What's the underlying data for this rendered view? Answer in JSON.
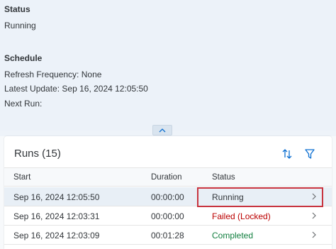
{
  "status_section": {
    "title": "Status",
    "value": "Running"
  },
  "schedule_section": {
    "title": "Schedule",
    "refresh_frequency_label": "Refresh Frequency:",
    "refresh_frequency_value": "None",
    "latest_update_label": "Latest Update:",
    "latest_update_value": "Sep 16, 2024 12:05:50",
    "next_run_label": "Next Run:",
    "next_run_value": ""
  },
  "collapse_button": {
    "icon": "chevron-up-icon"
  },
  "runs": {
    "title": "Runs (15)",
    "toolbar": {
      "sort_icon": "sort-icon",
      "filter_icon": "filter-icon"
    },
    "columns": [
      "Start",
      "Duration",
      "Status"
    ],
    "rows": [
      {
        "start": "Sep 16, 2024 12:05:50",
        "duration": "00:00:00",
        "status": "Running",
        "status_color": "#32363a",
        "selected": true
      },
      {
        "start": "Sep 16, 2024 12:03:31",
        "duration": "00:00:00",
        "status": "Failed (Locked)",
        "status_color": "#bb0000",
        "selected": false
      },
      {
        "start": "Sep 16, 2024 12:03:09",
        "duration": "00:01:28",
        "status": "Completed",
        "status_color": "#107e3e",
        "selected": false
      }
    ]
  },
  "colors": {
    "accent_highlight": "#c8343f",
    "error": "#bb0000",
    "success": "#107e3e"
  }
}
